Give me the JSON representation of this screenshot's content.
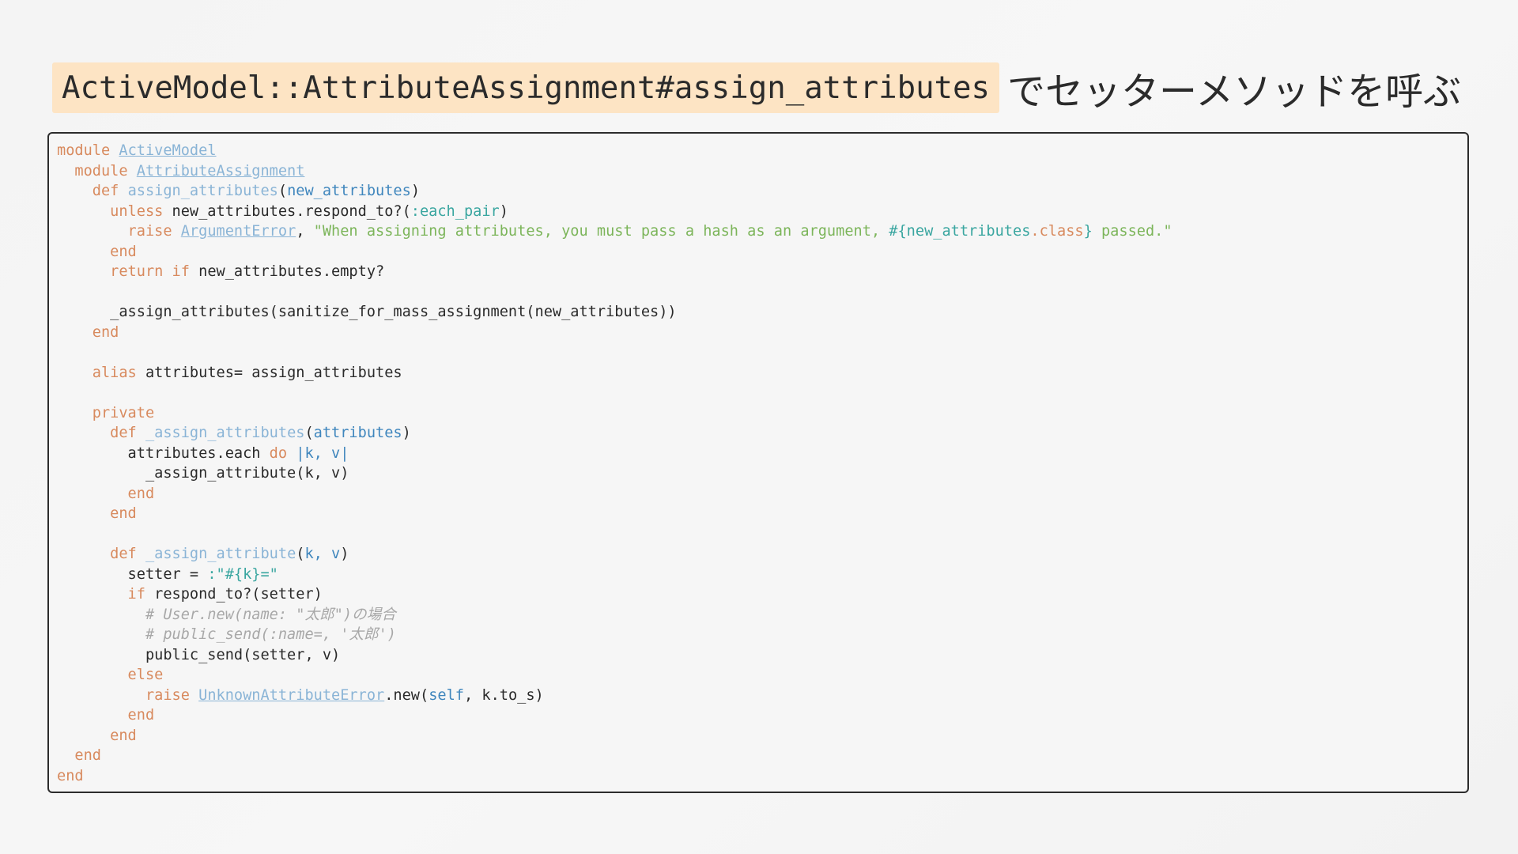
{
  "slide": {
    "title_code": "ActiveModel::AttributeAssignment#assign_attributes",
    "title_text": "でセッターメソッドを呼ぶ"
  },
  "code_block": {
    "language": "ruby",
    "lines": [
      [
        {
          "c": "kw",
          "t": "module "
        },
        {
          "c": "const",
          "t": "ActiveModel"
        }
      ],
      [
        {
          "c": "kw",
          "t": "  module "
        },
        {
          "c": "const",
          "t": "AttributeAssignment"
        }
      ],
      [
        {
          "c": "kw",
          "t": "    def "
        },
        {
          "c": "meth",
          "t": "assign_attributes"
        },
        {
          "c": "plain",
          "t": "("
        },
        {
          "c": "param",
          "t": "new_attributes"
        },
        {
          "c": "plain",
          "t": ")"
        }
      ],
      [
        {
          "c": "kw",
          "t": "      unless "
        },
        {
          "c": "plain",
          "t": "new_attributes.respond_to?("
        },
        {
          "c": "sym",
          "t": ":each_pair"
        },
        {
          "c": "plain",
          "t": ")"
        }
      ],
      [
        {
          "c": "kw",
          "t": "        raise "
        },
        {
          "c": "const",
          "t": "ArgumentError"
        },
        {
          "c": "plain",
          "t": ", "
        },
        {
          "c": "str",
          "t": "\"When assigning attributes, you must pass a hash as an argument, "
        },
        {
          "c": "interp",
          "t": "#{new_attributes"
        },
        {
          "c": "kw",
          "t": ".class"
        },
        {
          "c": "interp",
          "t": "}"
        },
        {
          "c": "str",
          "t": " passed.\""
        }
      ],
      [
        {
          "c": "kw",
          "t": "      end"
        }
      ],
      [
        {
          "c": "kw",
          "t": "      return if "
        },
        {
          "c": "plain",
          "t": "new_attributes.empty?"
        }
      ],
      [],
      [
        {
          "c": "plain",
          "t": "      _assign_attributes(sanitize_for_mass_assignment(new_attributes))"
        }
      ],
      [
        {
          "c": "kw",
          "t": "    end"
        }
      ],
      [],
      [
        {
          "c": "kw",
          "t": "    alias "
        },
        {
          "c": "plain",
          "t": "attributes= assign_attributes"
        }
      ],
      [],
      [
        {
          "c": "kw",
          "t": "    private"
        }
      ],
      [
        {
          "c": "kw",
          "t": "      def "
        },
        {
          "c": "meth",
          "t": "_assign_attributes"
        },
        {
          "c": "plain",
          "t": "("
        },
        {
          "c": "param",
          "t": "attributes"
        },
        {
          "c": "plain",
          "t": ")"
        }
      ],
      [
        {
          "c": "plain",
          "t": "        attributes.each "
        },
        {
          "c": "kw",
          "t": "do "
        },
        {
          "c": "param",
          "t": "|k, v|"
        }
      ],
      [
        {
          "c": "plain",
          "t": "          _assign_attribute(k, v)"
        }
      ],
      [
        {
          "c": "kw",
          "t": "        end"
        }
      ],
      [
        {
          "c": "kw",
          "t": "      end"
        }
      ],
      [],
      [
        {
          "c": "kw",
          "t": "      def "
        },
        {
          "c": "meth",
          "t": "_assign_attribute"
        },
        {
          "c": "plain",
          "t": "("
        },
        {
          "c": "param",
          "t": "k, v"
        },
        {
          "c": "plain",
          "t": ")"
        }
      ],
      [
        {
          "c": "plain",
          "t": "        setter = "
        },
        {
          "c": "sym",
          "t": ":\"#{k}=\""
        }
      ],
      [
        {
          "c": "kw",
          "t": "        if "
        },
        {
          "c": "plain",
          "t": "respond_to?(setter)"
        }
      ],
      [
        {
          "c": "comment",
          "t": "          # User.new(name: \"太郎\")の場合"
        }
      ],
      [
        {
          "c": "comment",
          "t": "          # public_send(:name=, '太郎')"
        }
      ],
      [
        {
          "c": "plain",
          "t": "          public_send(setter, v)"
        }
      ],
      [
        {
          "c": "kw",
          "t": "        else"
        }
      ],
      [
        {
          "c": "kw",
          "t": "          raise "
        },
        {
          "c": "const",
          "t": "UnknownAttributeError"
        },
        {
          "c": "plain",
          "t": ".new("
        },
        {
          "c": "param",
          "t": "self"
        },
        {
          "c": "plain",
          "t": ", k.to_s)"
        }
      ],
      [
        {
          "c": "kw",
          "t": "        end"
        }
      ],
      [
        {
          "c": "kw",
          "t": "      end"
        }
      ],
      [
        {
          "c": "kw",
          "t": "  end"
        }
      ],
      [
        {
          "c": "kw",
          "t": "end"
        }
      ]
    ]
  },
  "colors": {
    "keyword": "#d88a5e",
    "constant": "#8ab4d6",
    "parameter": "#3f86bd",
    "symbol": "#3aa6a0",
    "string": "#7cb55a",
    "comment": "#a8a8a8",
    "title_highlight": "#fde4c4"
  }
}
